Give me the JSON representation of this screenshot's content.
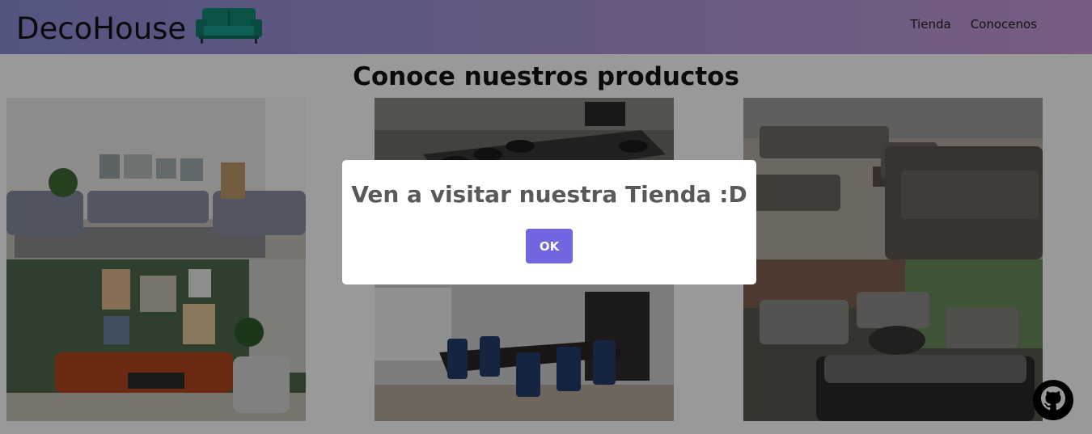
{
  "navbar": {
    "brand": "DecoHouse",
    "brand_icon": "sofa-icon",
    "links": [
      "Tienda",
      "Conocenos"
    ]
  },
  "main": {
    "title": "Conoce nuestros productos",
    "products": [
      "living-room-gray-sofas",
      "outdoor-dining-table",
      "outdoor-patio-lounge",
      "green-wall-living-room",
      "blue-chairs-dining-room",
      "glass-sunroom-lounge"
    ]
  },
  "modal": {
    "title": "Ven a visitar nuestra Tienda :D",
    "confirm_label": "OK"
  },
  "fab": {
    "icon": "github-icon"
  },
  "colors": {
    "navbar_gradient_start": "#8a8ed8",
    "navbar_gradient_end": "#c79bd7",
    "sofa": "#128a76",
    "confirm_button": "#7066e0",
    "overlay": "rgba(0,0,0,0.4)"
  }
}
